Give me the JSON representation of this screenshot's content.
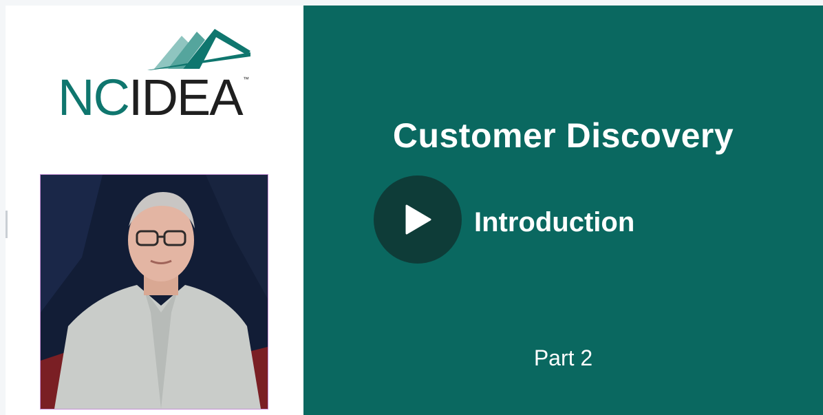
{
  "theme": {
    "page_bg": "#f4f6f8",
    "teal": "#0a6860",
    "play_bg": "#0e3c38"
  },
  "logo": {
    "brand": "NCIDEA",
    "part1": "NC",
    "part2": "IDEA",
    "tm": "™"
  },
  "slide": {
    "title": "Customer Discovery",
    "subtitle": "Introduction",
    "part": "Part 2"
  },
  "icons": {
    "play": "play-icon",
    "logo": "logo-mark-icon"
  }
}
